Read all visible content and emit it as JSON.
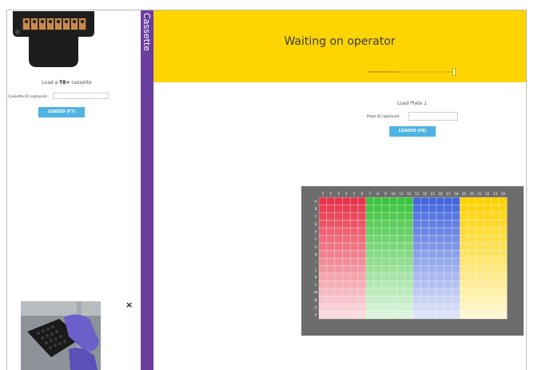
{
  "left_panel": {
    "load_prefix": "Load a ",
    "cassette_type": "T8+",
    "load_suffix": " cassette",
    "cassette_id_label": "Cassette ID (optional)",
    "cassette_id_value": "",
    "loaded_button": "LOADED (F7)",
    "close_label": "×"
  },
  "tab": {
    "label": "Cassette"
  },
  "banner": {
    "status": "Waiting on operator",
    "slider_level": 1.0
  },
  "plate_section": {
    "title": "Load Plate 1",
    "plate_id_label": "Plate ID (optional)",
    "plate_id_value": "",
    "loaded_button": "LOADED (F8)"
  },
  "plate": {
    "columns": [
      "1",
      "2",
      "3",
      "4",
      "5",
      "6",
      "7",
      "8",
      "9",
      "10",
      "11",
      "12",
      "13",
      "14",
      "15",
      "16",
      "17",
      "18",
      "19",
      "20",
      "21",
      "22",
      "23",
      "24"
    ],
    "rows": [
      "A",
      "B",
      "C",
      "D",
      "E",
      "F",
      "G",
      "H",
      "I",
      "J",
      "K",
      "L",
      "M",
      "N",
      "O",
      "P"
    ],
    "column_groups": [
      {
        "from": 1,
        "to": 6,
        "color": "#e8334a"
      },
      {
        "from": 7,
        "to": 12,
        "color": "#3cc43c"
      },
      {
        "from": 13,
        "to": 18,
        "color": "#4466dd"
      },
      {
        "from": 19,
        "to": 24,
        "color": "#ffd200"
      }
    ]
  }
}
